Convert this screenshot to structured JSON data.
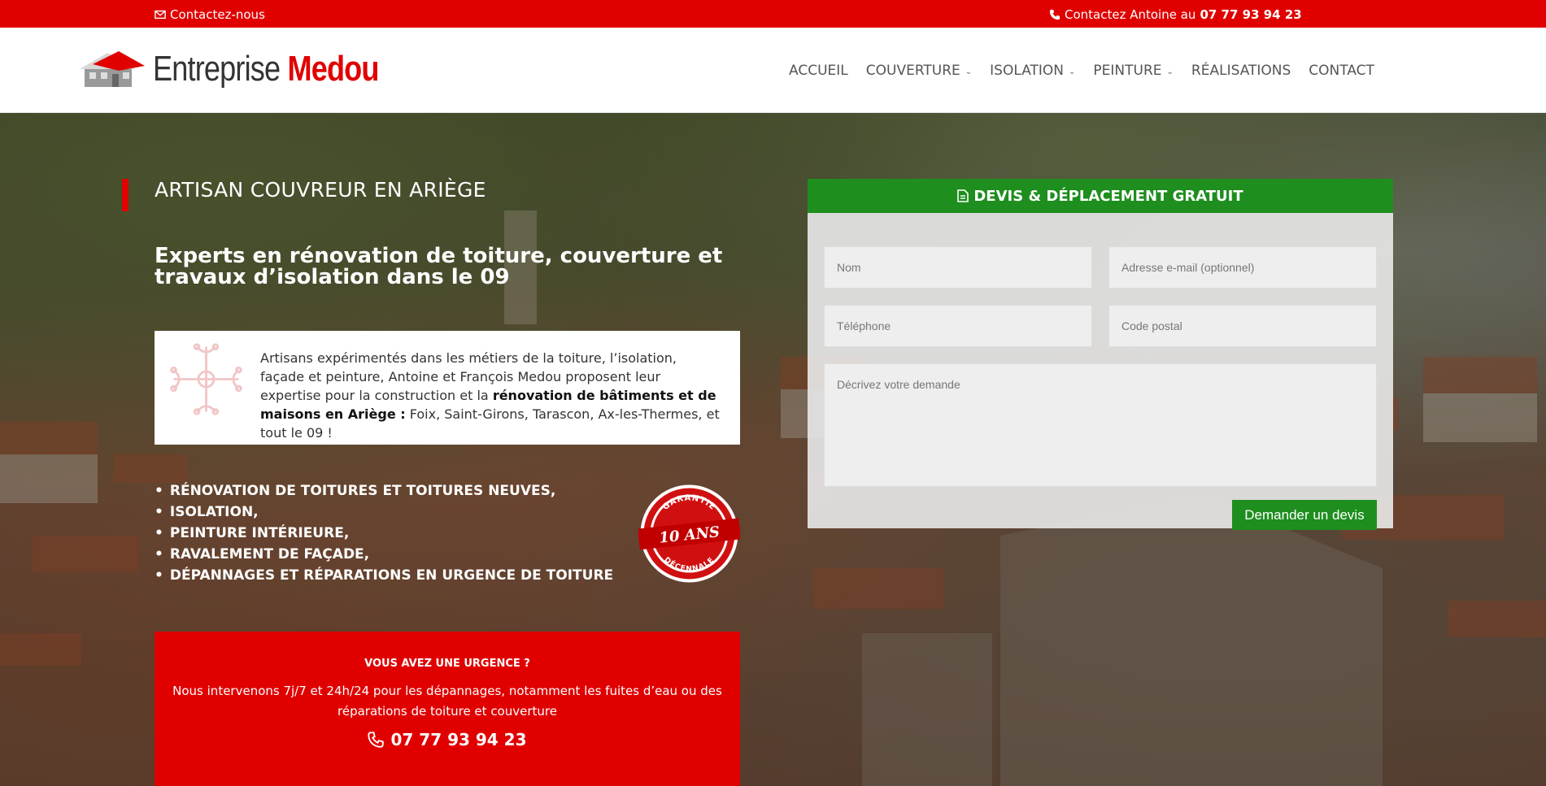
{
  "topbar": {
    "contact_label": "Contactez-nous",
    "call_label": "Contactez Antoine au",
    "call_number": "07 77 93 94 23"
  },
  "header": {
    "logo_text": "Entreprise",
    "logo_brand": "Medou",
    "nav": [
      {
        "label": "ACCUEIL",
        "has_dropdown": false
      },
      {
        "label": "COUVERTURE",
        "has_dropdown": true
      },
      {
        "label": "ISOLATION",
        "has_dropdown": true
      },
      {
        "label": "PEINTURE",
        "has_dropdown": true
      },
      {
        "label": "RÉALISATIONS",
        "has_dropdown": false
      },
      {
        "label": "CONTACT",
        "has_dropdown": false
      }
    ]
  },
  "hero": {
    "tagline": "ARTISAN COUVREUR EN ARIÈGE",
    "subtitle": "Experts en rénovation de toiture, couverture et travaux d’isolation dans le 09",
    "intro_part1": "Artisans expérimentés dans les métiers de la toiture, l’isolation, façade et peinture, Antoine et François Medou proposent leur expertise pour la construction et la ",
    "intro_bold": "rénovation de bâtiments et de maisons en Ariège :",
    "intro_part2": " Foix, Saint-Girons, Tarascon, Ax-les-Thermes, et tout le 09 !",
    "services": [
      "RÉNOVATION DE TOITURES ET TOITURES NEUVES,",
      "ISOLATION,",
      "PEINTURE INTÉRIEURE,",
      "RAVALEMENT DE FAÇADE,",
      "DÉPANNAGES ET RÉPARATIONS EN URGENCE DE TOITURE"
    ],
    "badge": {
      "top": "GARANTIE",
      "center": "10 ANS",
      "bottom": "DÉCENNALE"
    },
    "urgent": {
      "title": "VOUS AVEZ UNE URGENCE ?",
      "text": "Nous intervenons 7j/7 et 24h/24 pour les dépannages, notamment les fuites d’eau ou des réparations de toiture et couverture",
      "phone": "07 77 93 94 23"
    }
  },
  "form": {
    "title": "DEVIS & DÉPLACEMENT GRATUIT",
    "name_placeholder": "Nom",
    "email_placeholder": "Adresse e-mail (optionnel)",
    "phone_placeholder": "Téléphone",
    "postal_placeholder": "Code postal",
    "message_placeholder": "Décrivez votre demande",
    "submit_label": "Demander un devis"
  },
  "colors": {
    "accent_red": "#e00000",
    "accent_green": "#1e8e1e"
  }
}
